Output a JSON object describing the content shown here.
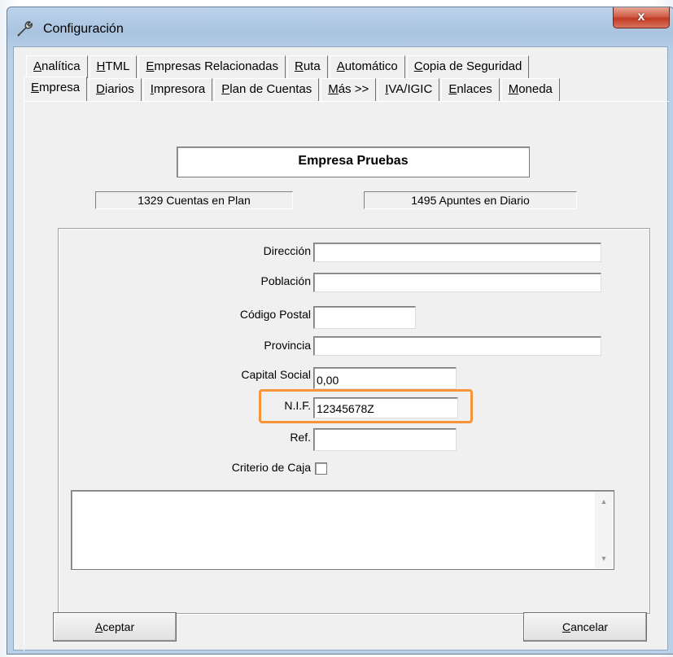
{
  "window": {
    "title": "Configuración",
    "close_label": "x"
  },
  "tabs": {
    "back_row": [
      {
        "label": "Analítica",
        "mnemonic": "A",
        "rest": "nalítica"
      },
      {
        "label": "HTML",
        "mnemonic": "H",
        "rest": "TML"
      },
      {
        "label": "Empresas Relacionadas",
        "mnemonic": "E",
        "rest": "mpresas Relacionadas"
      },
      {
        "label": "Ruta",
        "mnemonic": "R",
        "rest": "uta"
      },
      {
        "label": "Automático",
        "mnemonic": "A",
        "rest": "utomático"
      },
      {
        "label": "Copia de Seguridad",
        "mnemonic": "C",
        "rest": "opia de Seguridad"
      }
    ],
    "front_row": [
      {
        "label": "Empresa",
        "mnemonic": "E",
        "rest": "mpresa",
        "active": true
      },
      {
        "label": "Diarios",
        "mnemonic": "D",
        "rest": "iarios"
      },
      {
        "label": "Impresora",
        "mnemonic": "I",
        "rest": "mpresora"
      },
      {
        "label": "Plan de Cuentas",
        "mnemonic": "P",
        "rest": "lan de Cuentas"
      },
      {
        "label": "Más >>",
        "mnemonic": "M",
        "rest": "ás >>"
      },
      {
        "label": "IVA/IGIC",
        "mnemonic": "I",
        "rest": "VA/IGIC"
      },
      {
        "label": "Enlaces",
        "mnemonic": "E",
        "rest": "nlaces"
      },
      {
        "label": "Moneda",
        "mnemonic": "M",
        "rest": "oneda"
      }
    ]
  },
  "company": {
    "name": "Empresa Pruebas",
    "accounts_info": "1329 Cuentas en Plan",
    "entries_info": "1495 Apuntes en Diario"
  },
  "form": {
    "direccion_label": "Dirección",
    "direccion_value": "",
    "poblacion_label": "Población",
    "poblacion_value": "",
    "codigo_postal_label": "Código Postal",
    "codigo_postal_value": "",
    "provincia_label": "Provincia",
    "provincia_value": "",
    "capital_social_label": "Capital Social",
    "capital_social_value": "0,00",
    "nif_label": "N.I.F.",
    "nif_value": "12345678Z",
    "ref_label": "Ref.",
    "ref_value": "",
    "criterio_caja_label": "Criterio de Caja",
    "criterio_caja_checked": false,
    "notes_value": ""
  },
  "buttons": {
    "accept_mnemonic": "A",
    "accept_rest": "ceptar",
    "cancel_mnemonic": "C",
    "cancel_rest": "ancelar"
  },
  "colors": {
    "highlight": "#f5943a",
    "close_button": "#c23a22"
  }
}
